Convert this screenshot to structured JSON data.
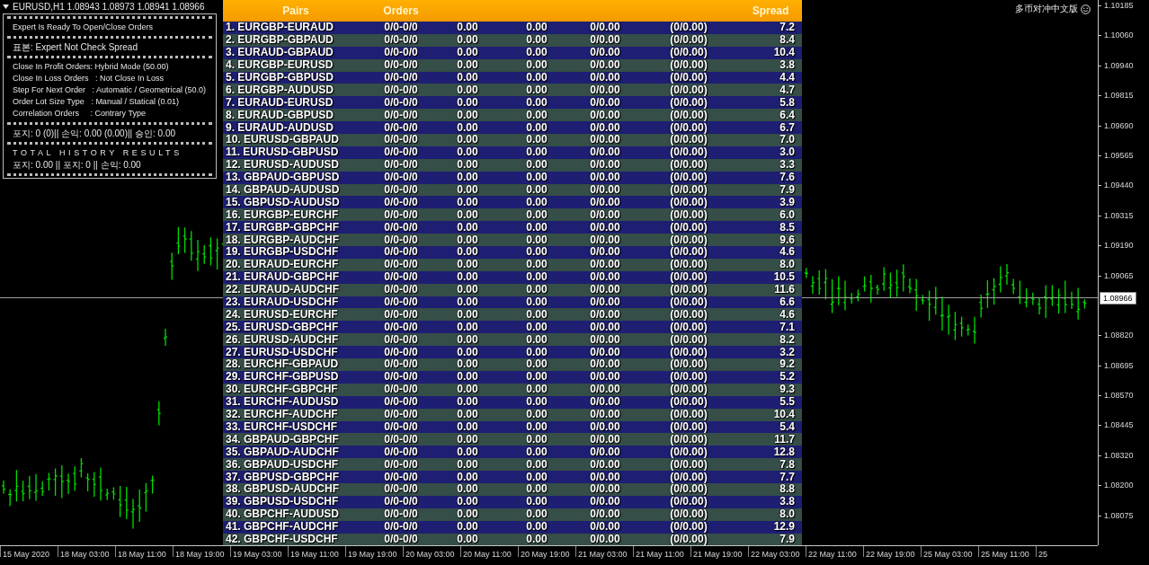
{
  "chart_header": {
    "title": "EURUSD,H1  1.08943 1.08973 1.08941 1.08966"
  },
  "ea_label": "多币对冲中文版",
  "info_panel": {
    "sections": [
      {
        "lines": [
          {
            "kind": "text",
            "text": "Expert Is Ready To Open/Close Orders"
          }
        ]
      },
      {
        "lines": [
          {
            "kind": "text",
            "text": "표본: Expert Not Check Spread"
          }
        ]
      },
      {
        "lines": [
          {
            "kind": "text",
            "text": "Close In Profit Orders: Hybrid Mode (50.00)"
          },
          {
            "kind": "text",
            "text": "Close In Loss Orders   : Not Close In Loss"
          },
          {
            "kind": "text",
            "text": "Step For Next Order   : Automatic / Geometrical (50.0)"
          },
          {
            "kind": "text",
            "text": "Order Lot Size Type   : Manual / Statical (0.01)"
          },
          {
            "kind": "text",
            "text": "Correlation Orders     : Contrary Type"
          }
        ]
      },
      {
        "lines": [
          {
            "kind": "text",
            "text": "포지: 0 (0)|| 손익: 0.00 (0.00)|| 승인: 0.00"
          }
        ]
      },
      {
        "lines": [
          {
            "kind": "heading",
            "text": "TOTAL HISTORY RESULTS"
          },
          {
            "kind": "text",
            "text": "포지: 0.00 || 포지: 0 || 손익: 0.00"
          }
        ]
      }
    ]
  },
  "table": {
    "header": {
      "column_1": "Pairs",
      "column_2": "Orders",
      "column_7": "Spread"
    },
    "rows": [
      {
        "pair": "1. EURGBP-EURAUD",
        "orders": "0/0-0/0",
        "column_3": "0.00",
        "column_4": "0.00",
        "column_5": "0/0.00",
        "column_6": "(0/0.00)",
        "spread": "7.2"
      },
      {
        "pair": "2. EURGBP-GBPAUD",
        "orders": "0/0-0/0",
        "column_3": "0.00",
        "column_4": "0.00",
        "column_5": "0/0.00",
        "column_6": "(0/0.00)",
        "spread": "8.4"
      },
      {
        "pair": "3. EURAUD-GBPAUD",
        "orders": "0/0-0/0",
        "column_3": "0.00",
        "column_4": "0.00",
        "column_5": "0/0.00",
        "column_6": "(0/0.00)",
        "spread": "10.4"
      },
      {
        "pair": "4. EURGBP-EURUSD",
        "orders": "0/0-0/0",
        "column_3": "0.00",
        "column_4": "0.00",
        "column_5": "0/0.00",
        "column_6": "(0/0.00)",
        "spread": "3.8"
      },
      {
        "pair": "5. EURGBP-GBPUSD",
        "orders": "0/0-0/0",
        "column_3": "0.00",
        "column_4": "0.00",
        "column_5": "0/0.00",
        "column_6": "(0/0.00)",
        "spread": "4.4"
      },
      {
        "pair": "6. EURGBP-AUDUSD",
        "orders": "0/0-0/0",
        "column_3": "0.00",
        "column_4": "0.00",
        "column_5": "0/0.00",
        "column_6": "(0/0.00)",
        "spread": "4.7"
      },
      {
        "pair": "7. EURAUD-EURUSD",
        "orders": "0/0-0/0",
        "column_3": "0.00",
        "column_4": "0.00",
        "column_5": "0/0.00",
        "column_6": "(0/0.00)",
        "spread": "5.8"
      },
      {
        "pair": "8. EURAUD-GBPUSD",
        "orders": "0/0-0/0",
        "column_3": "0.00",
        "column_4": "0.00",
        "column_5": "0/0.00",
        "column_6": "(0/0.00)",
        "spread": "6.4"
      },
      {
        "pair": "9. EURAUD-AUDUSD",
        "orders": "0/0-0/0",
        "column_3": "0.00",
        "column_4": "0.00",
        "column_5": "0/0.00",
        "column_6": "(0/0.00)",
        "spread": "6.7"
      },
      {
        "pair": "10. EURUSD-GBPAUD",
        "orders": "0/0-0/0",
        "column_3": "0.00",
        "column_4": "0.00",
        "column_5": "0/0.00",
        "column_6": "(0/0.00)",
        "spread": "7.0"
      },
      {
        "pair": "11. EURUSD-GBPUSD",
        "orders": "0/0-0/0",
        "column_3": "0.00",
        "column_4": "0.00",
        "column_5": "0/0.00",
        "column_6": "(0/0.00)",
        "spread": "3.0"
      },
      {
        "pair": "12. EURUSD-AUDUSD",
        "orders": "0/0-0/0",
        "column_3": "0.00",
        "column_4": "0.00",
        "column_5": "0/0.00",
        "column_6": "(0/0.00)",
        "spread": "3.3"
      },
      {
        "pair": "13. GBPAUD-GBPUSD",
        "orders": "0/0-0/0",
        "column_3": "0.00",
        "column_4": "0.00",
        "column_5": "0/0.00",
        "column_6": "(0/0.00)",
        "spread": "7.6"
      },
      {
        "pair": "14. GBPAUD-AUDUSD",
        "orders": "0/0-0/0",
        "column_3": "0.00",
        "column_4": "0.00",
        "column_5": "0/0.00",
        "column_6": "(0/0.00)",
        "spread": "7.9"
      },
      {
        "pair": "15. GBPUSD-AUDUSD",
        "orders": "0/0-0/0",
        "column_3": "0.00",
        "column_4": "0.00",
        "column_5": "0/0.00",
        "column_6": "(0/0.00)",
        "spread": "3.9"
      },
      {
        "pair": "16. EURGBP-EURCHF",
        "orders": "0/0-0/0",
        "column_3": "0.00",
        "column_4": "0.00",
        "column_5": "0/0.00",
        "column_6": "(0/0.00)",
        "spread": "6.0"
      },
      {
        "pair": "17. EURGBP-GBPCHF",
        "orders": "0/0-0/0",
        "column_3": "0.00",
        "column_4": "0.00",
        "column_5": "0/0.00",
        "column_6": "(0/0.00)",
        "spread": "8.5"
      },
      {
        "pair": "18. EURGBP-AUDCHF",
        "orders": "0/0-0/0",
        "column_3": "0.00",
        "column_4": "0.00",
        "column_5": "0/0.00",
        "column_6": "(0/0.00)",
        "spread": "9.6"
      },
      {
        "pair": "19. EURGBP-USDCHF",
        "orders": "0/0-0/0",
        "column_3": "0.00",
        "column_4": "0.00",
        "column_5": "0/0.00",
        "column_6": "(0/0.00)",
        "spread": "4.6"
      },
      {
        "pair": "20. EURAUD-EURCHF",
        "orders": "0/0-0/0",
        "column_3": "0.00",
        "column_4": "0.00",
        "column_5": "0/0.00",
        "column_6": "(0/0.00)",
        "spread": "8.0"
      },
      {
        "pair": "21. EURAUD-GBPCHF",
        "orders": "0/0-0/0",
        "column_3": "0.00",
        "column_4": "0.00",
        "column_5": "0/0.00",
        "column_6": "(0/0.00)",
        "spread": "10.5"
      },
      {
        "pair": "22. EURAUD-AUDCHF",
        "orders": "0/0-0/0",
        "column_3": "0.00",
        "column_4": "0.00",
        "column_5": "0/0.00",
        "column_6": "(0/0.00)",
        "spread": "11.6"
      },
      {
        "pair": "23. EURAUD-USDCHF",
        "orders": "0/0-0/0",
        "column_3": "0.00",
        "column_4": "0.00",
        "column_5": "0/0.00",
        "column_6": "(0/0.00)",
        "spread": "6.6"
      },
      {
        "pair": "24. EURUSD-EURCHF",
        "orders": "0/0-0/0",
        "column_3": "0.00",
        "column_4": "0.00",
        "column_5": "0/0.00",
        "column_6": "(0/0.00)",
        "spread": "4.6"
      },
      {
        "pair": "25. EURUSD-GBPCHF",
        "orders": "0/0-0/0",
        "column_3": "0.00",
        "column_4": "0.00",
        "column_5": "0/0.00",
        "column_6": "(0/0.00)",
        "spread": "7.1"
      },
      {
        "pair": "26. EURUSD-AUDCHF",
        "orders": "0/0-0/0",
        "column_3": "0.00",
        "column_4": "0.00",
        "column_5": "0/0.00",
        "column_6": "(0/0.00)",
        "spread": "8.2"
      },
      {
        "pair": "27. EURUSD-USDCHF",
        "orders": "0/0-0/0",
        "column_3": "0.00",
        "column_4": "0.00",
        "column_5": "0/0.00",
        "column_6": "(0/0.00)",
        "spread": "3.2"
      },
      {
        "pair": "28. EURCHF-GBPAUD",
        "orders": "0/0-0/0",
        "column_3": "0.00",
        "column_4": "0.00",
        "column_5": "0/0.00",
        "column_6": "(0/0.00)",
        "spread": "9.2"
      },
      {
        "pair": "29. EURCHF-GBPUSD",
        "orders": "0/0-0/0",
        "column_3": "0.00",
        "column_4": "0.00",
        "column_5": "0/0.00",
        "column_6": "(0/0.00)",
        "spread": "5.2"
      },
      {
        "pair": "30. EURCHF-GBPCHF",
        "orders": "0/0-0/0",
        "column_3": "0.00",
        "column_4": "0.00",
        "column_5": "0/0.00",
        "column_6": "(0/0.00)",
        "spread": "9.3"
      },
      {
        "pair": "31. EURCHF-AUDUSD",
        "orders": "0/0-0/0",
        "column_3": "0.00",
        "column_4": "0.00",
        "column_5": "0/0.00",
        "column_6": "(0/0.00)",
        "spread": "5.5"
      },
      {
        "pair": "32. EURCHF-AUDCHF",
        "orders": "0/0-0/0",
        "column_3": "0.00",
        "column_4": "0.00",
        "column_5": "0/0.00",
        "column_6": "(0/0.00)",
        "spread": "10.4"
      },
      {
        "pair": "33. EURCHF-USDCHF",
        "orders": "0/0-0/0",
        "column_3": "0.00",
        "column_4": "0.00",
        "column_5": "0/0.00",
        "column_6": "(0/0.00)",
        "spread": "5.4"
      },
      {
        "pair": "34. GBPAUD-GBPCHF",
        "orders": "0/0-0/0",
        "column_3": "0.00",
        "column_4": "0.00",
        "column_5": "0/0.00",
        "column_6": "(0/0.00)",
        "spread": "11.7"
      },
      {
        "pair": "35. GBPAUD-AUDCHF",
        "orders": "0/0-0/0",
        "column_3": "0.00",
        "column_4": "0.00",
        "column_5": "0/0.00",
        "column_6": "(0/0.00)",
        "spread": "12.8"
      },
      {
        "pair": "36. GBPAUD-USDCHF",
        "orders": "0/0-0/0",
        "column_3": "0.00",
        "column_4": "0.00",
        "column_5": "0/0.00",
        "column_6": "(0/0.00)",
        "spread": "7.8"
      },
      {
        "pair": "37. GBPUSD-GBPCHF",
        "orders": "0/0-0/0",
        "column_3": "0.00",
        "column_4": "0.00",
        "column_5": "0/0.00",
        "column_6": "(0/0.00)",
        "spread": "7.7"
      },
      {
        "pair": "38. GBPUSD-AUDCHF",
        "orders": "0/0-0/0",
        "column_3": "0.00",
        "column_4": "0.00",
        "column_5": "0/0.00",
        "column_6": "(0/0.00)",
        "spread": "8.8"
      },
      {
        "pair": "39. GBPUSD-USDCHF",
        "orders": "0/0-0/0",
        "column_3": "0.00",
        "column_4": "0.00",
        "column_5": "0/0.00",
        "column_6": "(0/0.00)",
        "spread": "3.8"
      },
      {
        "pair": "40. GBPCHF-AUDUSD",
        "orders": "0/0-0/0",
        "column_3": "0.00",
        "column_4": "0.00",
        "column_5": "0/0.00",
        "column_6": "(0/0.00)",
        "spread": "8.0"
      },
      {
        "pair": "41. GBPCHF-AUDCHF",
        "orders": "0/0-0/0",
        "column_3": "0.00",
        "column_4": "0.00",
        "column_5": "0/0.00",
        "column_6": "(0/0.00)",
        "spread": "12.9"
      },
      {
        "pair": "42. GBPCHF-USDCHF",
        "orders": "0/0-0/0",
        "column_3": "0.00",
        "column_4": "0.00",
        "column_5": "0/0.00",
        "column_6": "(0/0.00)",
        "spread": "7.9"
      }
    ]
  },
  "price_axis": {
    "labels": [
      "1.10185",
      "1.10060",
      "1.09940",
      "1.09815",
      "1.09690",
      "1.09565",
      "1.09440",
      "1.09315",
      "1.09190",
      "1.09065",
      "1.08820",
      "1.08695",
      "1.08570",
      "1.08445",
      "1.08320",
      "1.08200",
      "1.08075"
    ],
    "current_price": "1.08966"
  },
  "time_axis": {
    "labels": [
      "15 May 2020",
      "18 May 03:00",
      "18 May 11:00",
      "18 May 19:00",
      "19 May 03:00",
      "19 May 11:00",
      "19 May 19:00",
      "20 May 03:00",
      "20 May 11:00",
      "20 May 19:00",
      "21 May 03:00",
      "21 May 11:00",
      "21 May 19:00",
      "22 May 03:00",
      "22 May 11:00",
      "22 May 19:00",
      "25 May 03:00",
      "25 May 11:00",
      "25"
    ]
  }
}
